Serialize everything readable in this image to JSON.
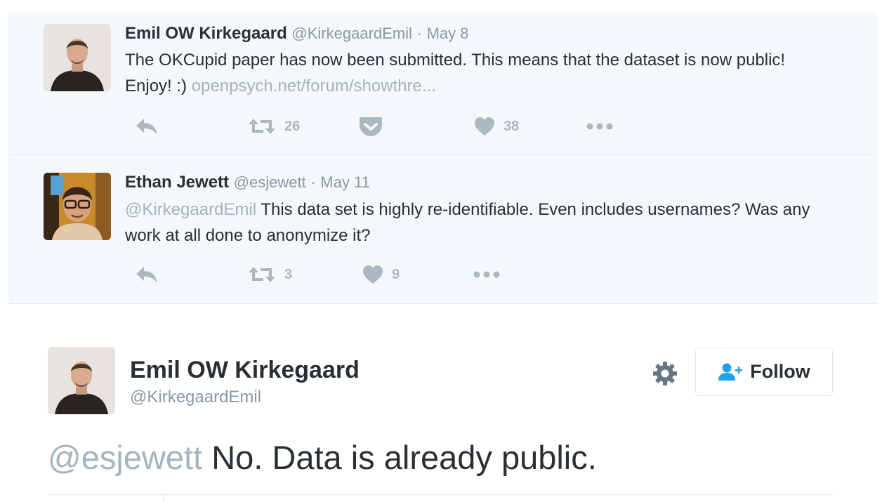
{
  "thread": [
    {
      "fullname": "Emil OW Kirkegaard",
      "handle": "@KirkegaardEmil",
      "separator": "·",
      "date": "May 8",
      "text": "The OKCupid paper has now been submitted. This means that the dataset is now public! Enjoy! :) ",
      "link": "openpsych.net/forum/showthre...",
      "retweets": "26",
      "likes": "38"
    },
    {
      "fullname": "Ethan Jewett",
      "handle": "@esjewett",
      "separator": "·",
      "date": "May 11",
      "mention": "@KirkegaardEmil",
      "text": " This data set is highly re-identifiable. Even includes usernames? Was any work at all done to anonymize it?",
      "retweets": "3",
      "likes": "9"
    }
  ],
  "main": {
    "fullname": "Emil OW Kirkegaard",
    "handle": "@KirkegaardEmil",
    "follow_label": "Follow",
    "mention": "@esjewett",
    "text": " No. Data is already public."
  },
  "icons": {
    "reply": "reply-icon",
    "retweet": "retweet-icon",
    "pocket": "pocket-icon",
    "like": "heart-icon",
    "more": "more-icon",
    "gear": "gear-icon",
    "follow": "follow-user-icon"
  },
  "colors": {
    "thread_bg": "#f5f8fa",
    "icon_grey": "#aab8c2",
    "meta_grey": "#8899a6",
    "follow_blue": "#1da1f2"
  }
}
